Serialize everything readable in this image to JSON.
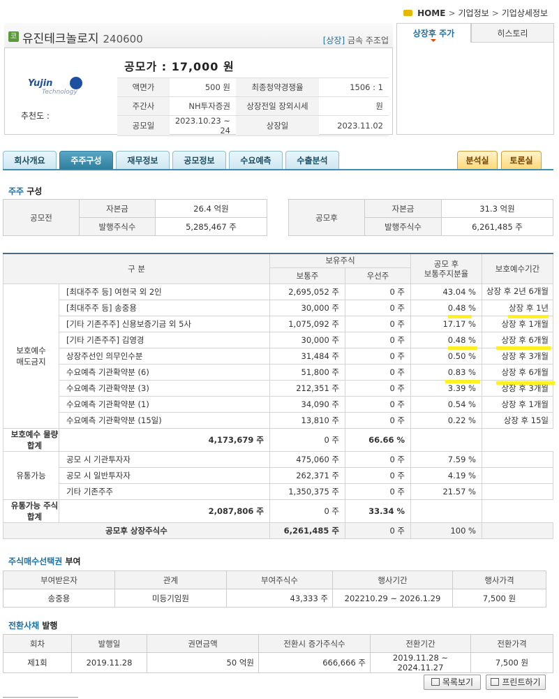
{
  "breadcrumb": {
    "home": "HOME",
    "items": [
      "기업정보",
      "기업상세정보"
    ]
  },
  "company": {
    "badge": "코",
    "name": "유진테크놀로지",
    "code": "240600",
    "market": "[상장]",
    "industry": "금속 주조업",
    "logo_text1": "Yujin",
    "logo_text2": "Technology",
    "recommend": "추천도 :",
    "price": "공모가 : 17,000 원",
    "info": [
      {
        "l1": "액면가",
        "v1": "500 원",
        "l2": "최종청약경쟁율",
        "v2": "1506 : 1"
      },
      {
        "l1": "주간사",
        "v1": "NH투자증권",
        "l2": "상장전일 장외시세",
        "v2": "원"
      },
      {
        "l1": "공모일",
        "v1": "2023.10.23 ~ 24",
        "l2": "상장일",
        "v2": "2023.11.02"
      }
    ]
  },
  "side_tabs": [
    "상장후 주가",
    "히스토리"
  ],
  "tabs": [
    "회사개요",
    "주주구성",
    "재무정보",
    "공모정보",
    "수요예측",
    "수출분석"
  ],
  "right_tabs": [
    "분석실",
    "토론실"
  ],
  "section1": {
    "title_blue": "주주",
    "title_rest": " 구성"
  },
  "before": {
    "label": "공모전",
    "cap_label": "자본금",
    "cap": "26.4 억원",
    "shares_label": "발행주식수",
    "shares": "5,285,467 주"
  },
  "after": {
    "label": "공모후",
    "cap_label": "자본금",
    "cap": "31.3 억원",
    "shares_label": "발행주식수",
    "shares": "6,261,485 주"
  },
  "main_table": {
    "h_gubun": "구    분",
    "h_hold": "보유주식",
    "h_common": "보통주",
    "h_pref": "우선주",
    "h_ratio": "공모 후\n보통주지분율",
    "h_period": "보호예수기간",
    "group1": "보호예수\n매도금지",
    "group2": "유통가능",
    "rows1": [
      {
        "name": "[최대주주 등] 여현국 외 2인",
        "common": "2,695,052 주",
        "pref": "0 주",
        "ratio": "43.04 %",
        "period": "상장 후 2년 6개월"
      },
      {
        "name": "[최대주주 등] 송중용",
        "common": "30,000 주",
        "pref": "0 주",
        "ratio": "0.48 %",
        "period": "상장 후 1년"
      },
      {
        "name": "[기타 기존주주] 신용보증기금 외 5사",
        "common": "1,075,092 주",
        "pref": "0 주",
        "ratio": "17.17 %",
        "period": "상장 후 1개월"
      },
      {
        "name": "[기타 기존주주] 김영경",
        "common": "30,000 주",
        "pref": "0 주",
        "ratio": "0.48 %",
        "period": "상장 후 6개월"
      },
      {
        "name": "상장주선인 의무인수분",
        "common": "31,484 주",
        "pref": "0 주",
        "ratio": "0.50 %",
        "period": "상장 후 3개월"
      },
      {
        "name": "수요예측 기관확약분 (6)",
        "common": "51,800 주",
        "pref": "0 주",
        "ratio": "0.83 %",
        "period": "상장 후 6개월"
      },
      {
        "name": "수요예측 기관확약분 (3)",
        "common": "212,351 주",
        "pref": "0 주",
        "ratio": "3.39 %",
        "period": "상장 후 3개월"
      },
      {
        "name": "수요예측 기관확약분 (1)",
        "common": "34,090 주",
        "pref": "0 주",
        "ratio": "0.54 %",
        "period": "상장 후 1개월"
      },
      {
        "name": "수요예측 기관확약분 (15일)",
        "common": "13,810 주",
        "pref": "0 주",
        "ratio": "0.22 %",
        "period": "상장 후 15일"
      }
    ],
    "sub1": {
      "name": "보호예수 물량합계",
      "common": "4,173,679 주",
      "pref": "0 주",
      "ratio": "66.66 %"
    },
    "rows2": [
      {
        "name": "공모 시 기관투자자",
        "common": "475,060 주",
        "pref": "0 주",
        "ratio": "7.59 %"
      },
      {
        "name": "공모 시 일반투자자",
        "common": "262,371 주",
        "pref": "0 주",
        "ratio": "4.19 %"
      },
      {
        "name": "기타 기존주주",
        "common": "1,350,375 주",
        "pref": "0 주",
        "ratio": "21.57 %"
      }
    ],
    "sub2": {
      "name": "유통가능 주식합계",
      "common": "2,087,806 주",
      "pref": "0 주",
      "ratio": "33.34 %"
    },
    "total": {
      "name": "공모후 상장주식수",
      "common": "6,261,485 주",
      "pref": "0 주",
      "ratio": "100 %"
    }
  },
  "options": {
    "title_blue": "주식매수선택권",
    "title_rest": " 부여",
    "headers": [
      "부여받은자",
      "관계",
      "부여주식수",
      "행사기간",
      "행사가격"
    ],
    "row": [
      "송중용",
      "미등기임원",
      "43,333 주",
      "202210.29 ~ 2026.1.29",
      "7,500 원"
    ]
  },
  "bonds": {
    "title_blue": "전환사채",
    "title_rest": " 발행",
    "headers": [
      "회차",
      "발행일",
      "권면금액",
      "전환시 증가주식수",
      "전환기간",
      "전환가격"
    ],
    "row": [
      "제1회",
      "2019.11.28",
      "50 억원",
      "666,666 주",
      "2019.11.28 ~ 2024.11.27",
      "7,500 원"
    ]
  },
  "buttons": {
    "list": "목록보기",
    "print": "프린트하기"
  }
}
